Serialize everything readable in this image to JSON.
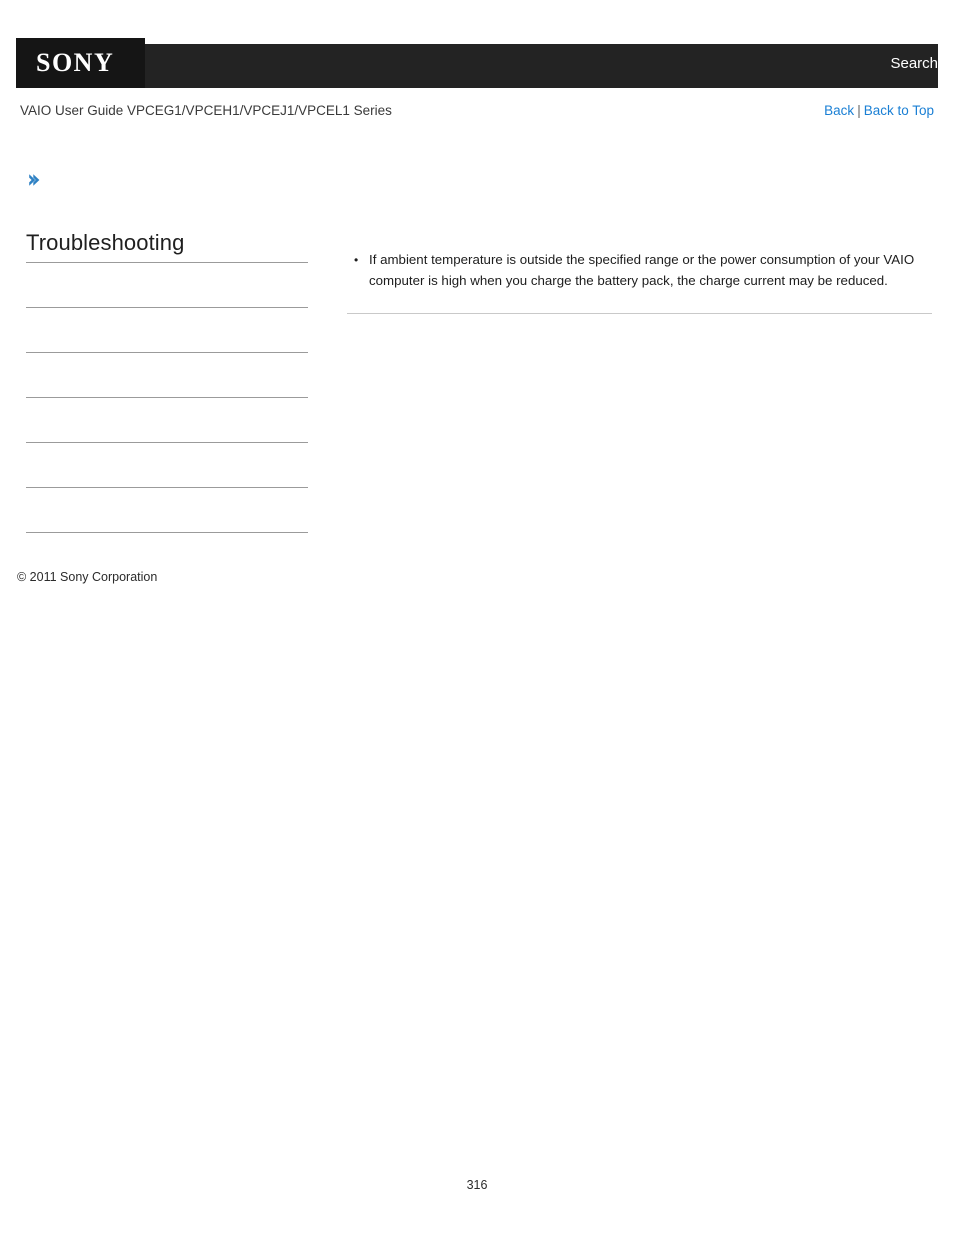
{
  "header": {
    "logo_text": "SONY",
    "search_label": "Search",
    "bar_color": "#232323",
    "logo_block_color": "#151515"
  },
  "subheader": {
    "guide_title": "VAIO User Guide VPCEG1/VPCEH1/VPCEJ1/VPCEL1 Series",
    "back_label": "Back",
    "separator": "|",
    "back_to_top_label": "Back to Top",
    "link_color": "#1a7fd4"
  },
  "breadcrumb": {
    "icon": "chevron-right-icon",
    "text": "",
    "color": "#2f82c4"
  },
  "sidebar": {
    "heading": "Troubleshooting",
    "items": [
      {
        "label": ""
      },
      {
        "label": ""
      },
      {
        "label": ""
      },
      {
        "label": ""
      },
      {
        "label": ""
      },
      {
        "label": ""
      },
      {
        "label": ""
      }
    ],
    "copyright": "© 2011 Sony Corporation"
  },
  "main": {
    "bullets": [
      "If ambient temperature is outside the specified range or the power consumption of your VAIO computer is high when you charge the battery pack, the charge current may be reduced."
    ]
  },
  "footer": {
    "page_number": "316"
  }
}
